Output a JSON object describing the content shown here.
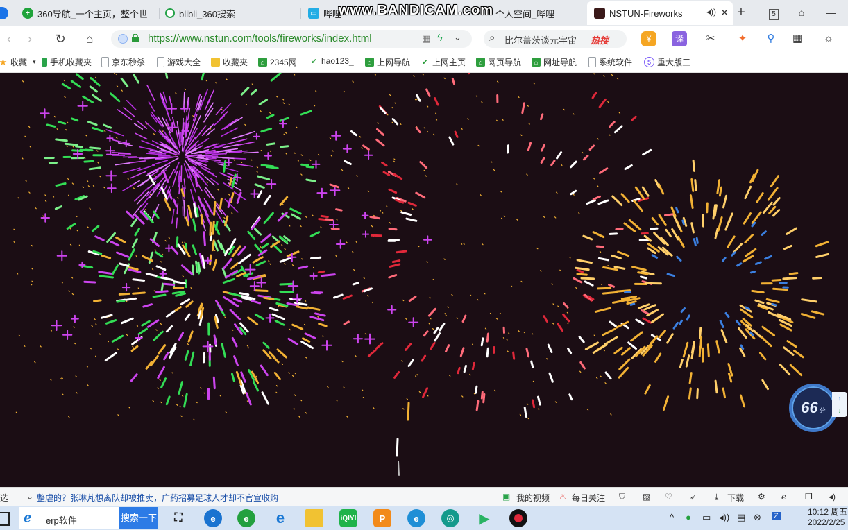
{
  "browser": {
    "tabs": [
      {
        "label": "360导航_一个主页，整个世",
        "icon": "360-nav-icon",
        "color": "#1fa33a"
      },
      {
        "label": "blibli_360搜索",
        "icon": "360-search-icon",
        "color": "#26a34a"
      },
      {
        "label": "哔哩",
        "icon": "bilibili-icon",
        "color": "#23ade5"
      },
      {
        "label": "个人空间_哔哩",
        "icon": "bilibili-icon",
        "color": "#23ade5"
      },
      {
        "label": "NSTUN-Fireworks",
        "icon": "nstun-icon",
        "color": "#3b1a1a",
        "active": true
      }
    ],
    "new_tab": "+",
    "tab_counter": "5",
    "overlay_watermark": "www.BANDICAM.com",
    "url": "https://www.nstun.com/tools/fireworks/index.html",
    "search_placeholder": "比尔盖茨谈元宇宙",
    "search_hot": "热搜",
    "translate_label": "译"
  },
  "bookmarks": [
    {
      "label": "收藏",
      "icon": "star-icon",
      "color": "#f5a623"
    },
    {
      "label": "手机收藏夹",
      "icon": "phone-icon",
      "color": "#2aa34a"
    },
    {
      "label": "京东秒杀",
      "icon": "page-icon",
      "color": "#9aa0a6"
    },
    {
      "label": "游戏大全",
      "icon": "page-icon",
      "color": "#9aa0a6"
    },
    {
      "label": "收藏夹",
      "icon": "folder-icon",
      "color": "#f1c232"
    },
    {
      "label": "2345网",
      "icon": "2345-icon",
      "color": "#2e9e3e"
    },
    {
      "label": "hao123_",
      "icon": "hao123-icon",
      "color": "#2e9e3e"
    },
    {
      "label": "上网导航",
      "icon": "2345-icon",
      "color": "#2e9e3e"
    },
    {
      "label": "上网主页",
      "icon": "hao123-icon",
      "color": "#2e9e3e"
    },
    {
      "label": "网页导航",
      "icon": "2345-icon",
      "color": "#2e9e3e"
    },
    {
      "label": "网址导航",
      "icon": "2345-icon",
      "color": "#2e9e3e"
    },
    {
      "label": "系统软件",
      "icon": "page-icon",
      "color": "#9aa0a6"
    },
    {
      "label": "重大版三",
      "icon": "s-icon",
      "color": "#7a5af8"
    }
  ],
  "score": {
    "value": "66",
    "unit": "分"
  },
  "statusbar": {
    "left": "选",
    "news": "整虐的？张琳芃想离队却被推卖，广药招募足球人才却不官宣收购",
    "my_video": "我的视频",
    "daily": "每日关注",
    "download": "下载"
  },
  "taskbar": {
    "search_app": "erp软件",
    "search_button": "搜索一下",
    "time": "10:12 周五",
    "date": "2022/2/25"
  },
  "colors": {
    "sky": "#1b0d14",
    "magenta": "#cc44ee",
    "green": "#33dd55",
    "gold": "#f2b134",
    "red": "#e0283a",
    "blue": "#3b7fe0"
  }
}
